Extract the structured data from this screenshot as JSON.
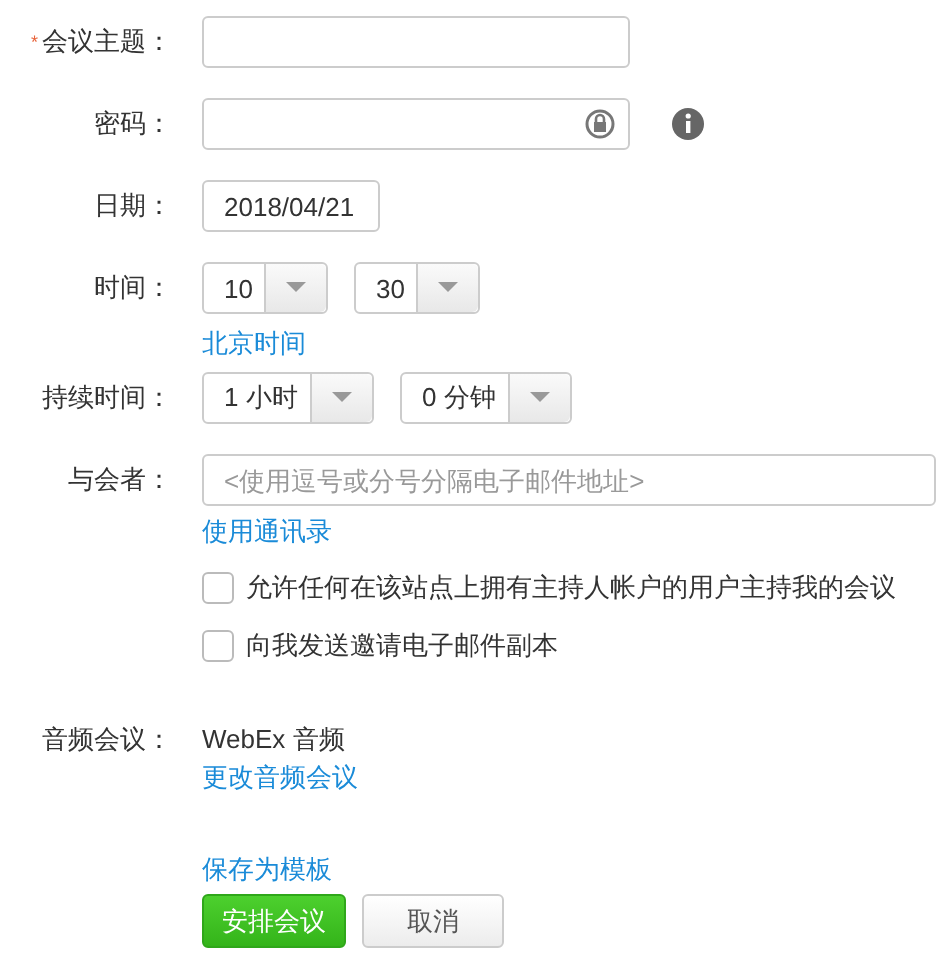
{
  "rows": [
    {
      "kind": "text",
      "label": "会议主题：",
      "mark": "*",
      "value": ""
    },
    {
      "kind": "password",
      "label": "密码：",
      "value": ""
    },
    {
      "kind": "date",
      "label": "日期：",
      "value": "2018/04/21"
    },
    {
      "kind": "selects",
      "label": "时间：",
      "selects": [
        "10",
        "30"
      ],
      "link": "北京时间"
    },
    {
      "kind": "selects",
      "label": "持续时间：",
      "selects": [
        "1 小时",
        "0 分钟"
      ]
    },
    {
      "kind": "attendees",
      "label": "与会者：",
      "placeholder": "<使用逗号或分号分隔电子邮件地址>",
      "link": "使用通讯录",
      "options": [
        {
          "label": "允许任何在该站点上拥有主持人帐户的用户主持我的会议",
          "checked": false
        },
        {
          "label": "向我发送邀请电子邮件副本",
          "checked": false
        }
      ]
    },
    {
      "kind": "static",
      "label": "音频会议：",
      "value": "WebEx 音频",
      "link": "更改音频会议"
    }
  ],
  "template_link": "保存为模板",
  "buttons": [
    {
      "label": "安排会议",
      "kind": "primary"
    },
    {
      "label": "取消",
      "kind": "secondary"
    }
  ]
}
